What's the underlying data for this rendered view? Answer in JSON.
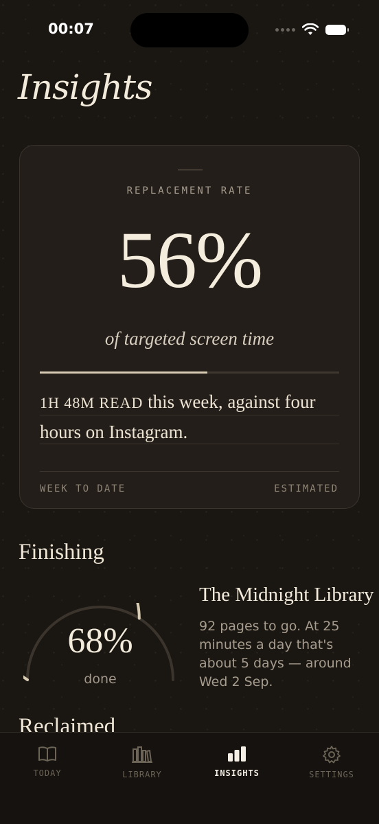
{
  "status_bar": {
    "time": "00:07"
  },
  "header": {
    "title": "Insights"
  },
  "replacement_card": {
    "eyebrow": "REPLACEMENT RATE",
    "percent": "56%",
    "subtitle": "of targeted screen time",
    "progress_fraction": 0.56,
    "body_lead": "1H 48M READ",
    "body_rest": " this week, against four hours on Instagram.",
    "footer_left": "WEEK TO DATE",
    "footer_right": "ESTIMATED"
  },
  "finishing": {
    "section_title": "Finishing",
    "gauge_percent_label": "68%",
    "gauge_fraction": 0.68,
    "gauge_caption": "done",
    "book_title": "The Midnight Library",
    "book_description": "92 pages to go. At 25 minutes a day that's about 5 days — around Wed 2 Sep."
  },
  "reclaimed": {
    "section_title": "Reclaimed"
  },
  "tab_bar": {
    "tabs": [
      {
        "label": "TODAY",
        "icon": "book-icon",
        "active": false
      },
      {
        "label": "LIBRARY",
        "icon": "bookshelf-icon",
        "active": false
      },
      {
        "label": "INSIGHTS",
        "icon": "bar-chart-icon",
        "active": true
      },
      {
        "label": "SETTINGS",
        "icon": "gear-icon",
        "active": false
      }
    ]
  },
  "colors": {
    "background": "#1a1612",
    "card": "#231e19",
    "accent": "#d8ccb4",
    "text_primary": "#f2eadb",
    "text_muted": "#a79d8f"
  }
}
